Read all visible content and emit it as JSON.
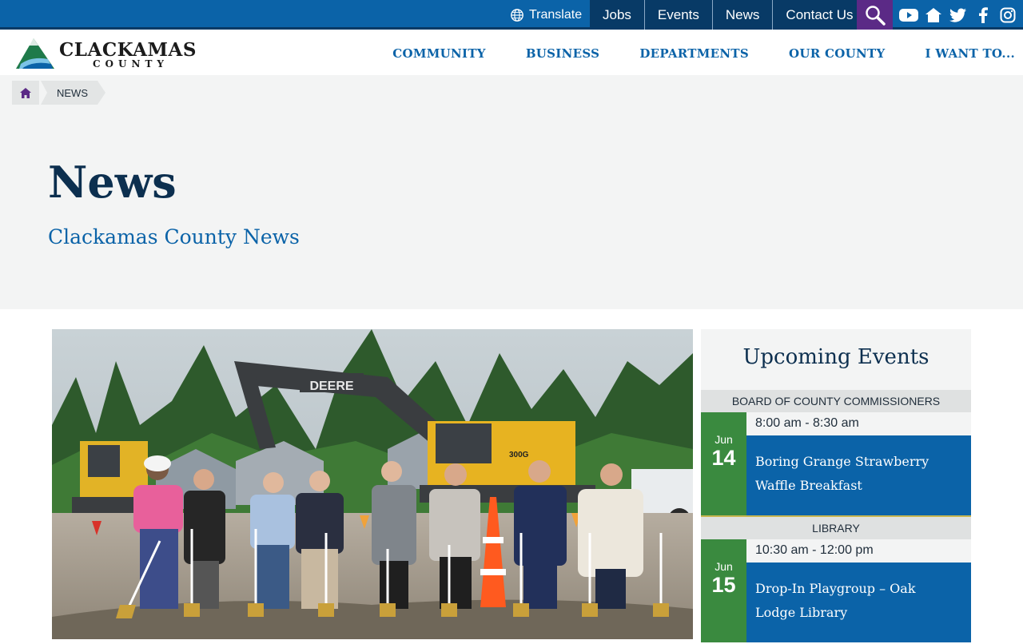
{
  "topbar": {
    "translate_label": "Translate",
    "links": [
      "Jobs",
      "Events",
      "News",
      "Contact Us"
    ],
    "socials": [
      "youtube-icon",
      "home-icon",
      "twitter-icon",
      "facebook-icon",
      "instagram-icon"
    ]
  },
  "header": {
    "logo_text": "CLACKAMAS",
    "logo_sub": "COUNTY",
    "nav": [
      "COMMUNITY",
      "BUSINESS",
      "DEPARTMENTS",
      "OUR COUNTY",
      "I WANT TO..."
    ]
  },
  "breadcrumb": {
    "current": "NEWS"
  },
  "hero": {
    "title": "News",
    "subtitle": "Clackamas County News"
  },
  "photo": {
    "machine_brand": "DEERE",
    "model": "300G"
  },
  "events": {
    "title": "Upcoming Events",
    "items": [
      {
        "category": "BOARD OF COUNTY COMMISSIONERS",
        "month": "Jun",
        "day": "14",
        "time": "8:00 am - 8:30 am",
        "name": "Boring Grange Strawberry Waffle Breakfast"
      },
      {
        "category": "LIBRARY",
        "month": "Jun",
        "day": "15",
        "time": "10:30 am - 12:00 pm",
        "name": "Drop-In Playgroup – Oak Lodge Library"
      }
    ]
  },
  "colors": {
    "primary_blue": "#0b63a8",
    "dark_navy": "#083a66",
    "search_purple": "#5b2a86",
    "date_green": "#3a8a3f",
    "title_navy": "#0c2f4f"
  }
}
